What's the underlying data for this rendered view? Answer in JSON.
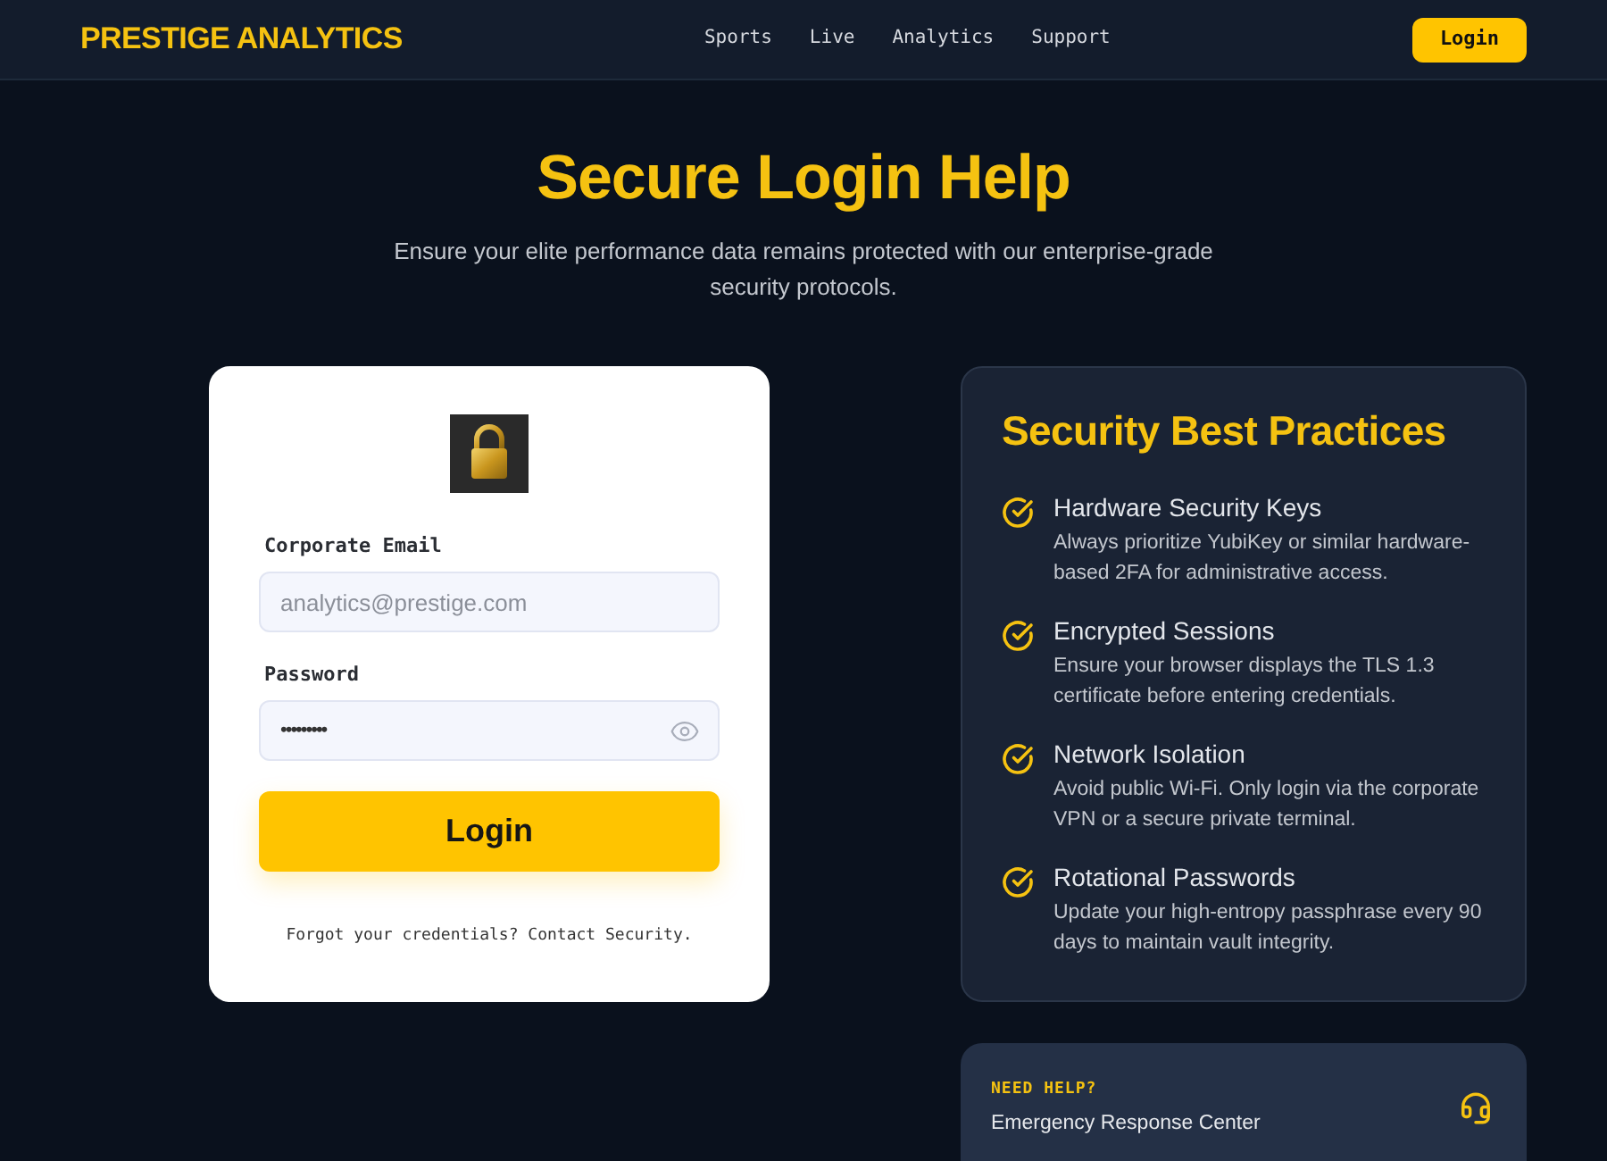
{
  "header": {
    "logo": "PRESTIGE ANALYTICS",
    "nav": [
      "Sports",
      "Live",
      "Analytics",
      "Support"
    ],
    "login_button": "Login"
  },
  "hero": {
    "title": "Secure Login Help",
    "subtitle": "Ensure your elite performance data remains protected with our enterprise-grade security protocols."
  },
  "login_card": {
    "fields": [
      {
        "kind": "email",
        "label": "Corporate Email",
        "placeholder": "analytics@prestige.com"
      },
      {
        "kind": "password",
        "label": "Password",
        "value": "•••••••••"
      }
    ],
    "submit": "Login",
    "footer": "Forgot your credentials? Contact Security."
  },
  "practices": {
    "title": "Security Best Practices",
    "items": [
      {
        "title": "Hardware Security Keys",
        "description": "Always prioritize YubiKey or similar hardware-based 2FA for administrative access."
      },
      {
        "title": "Encrypted Sessions",
        "description": "Ensure your browser displays the TLS 1.3 certificate before entering credentials."
      },
      {
        "title": "Network Isolation",
        "description": "Avoid public Wi-Fi. Only login via the corporate VPN or a secure private terminal."
      },
      {
        "title": "Rotational Passwords",
        "description": "Update your high-entropy passphrase every 90 days to maintain vault integrity."
      }
    ]
  },
  "help": {
    "eyebrow": "NEED HELP?",
    "title": "Emergency Response Center"
  }
}
